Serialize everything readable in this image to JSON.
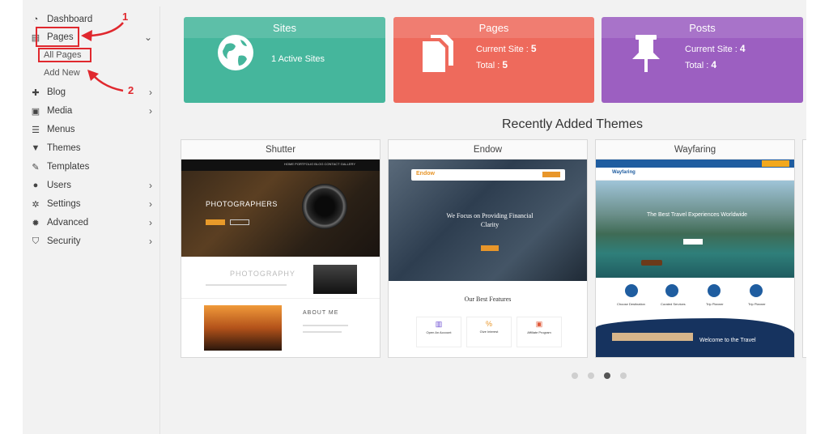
{
  "sidebar": {
    "items": [
      {
        "label": "Dashboard",
        "icon": "dashboard-icon"
      },
      {
        "label": "Pages",
        "icon": "pages-icon"
      },
      {
        "label": "Blog",
        "icon": "pin-icon"
      },
      {
        "label": "Media",
        "icon": "media-icon"
      },
      {
        "label": "Menus",
        "icon": "menu-list-icon"
      },
      {
        "label": "Themes",
        "icon": "brush-icon"
      },
      {
        "label": "Templates",
        "icon": "pencil-icon"
      },
      {
        "label": "Users",
        "icon": "user-icon"
      },
      {
        "label": "Settings",
        "icon": "gears-icon"
      },
      {
        "label": "Advanced",
        "icon": "cog-icon"
      },
      {
        "label": "Security",
        "icon": "shield-icon"
      }
    ],
    "pages_submenu": [
      "All Pages",
      "Add New"
    ]
  },
  "annotations": {
    "step1": "1",
    "step2": "2"
  },
  "cards": {
    "sites": {
      "title": "Sites",
      "line1": "1 Active Sites",
      "color": "#45b69c"
    },
    "pages": {
      "title": "Pages",
      "current_label": "Current Site :",
      "current_value": "5",
      "total_label": "Total :",
      "total_value": "5",
      "color": "#ee6a5c"
    },
    "posts": {
      "title": "Posts",
      "current_label": "Current Site :",
      "current_value": "4",
      "total_label": "Total :",
      "total_value": "4",
      "color": "#9c5fc1"
    }
  },
  "themes_section": {
    "title": "Recently Added Themes",
    "themes": [
      {
        "name": "Shutter",
        "preview": {
          "nav_links": "HOME   PORTFOLIO   BLOG   CONTACT   GALLERY",
          "hero_text": "PHOTOGRAPHERS",
          "section_text": "PHOTOGRAPHY",
          "about_text": "ABOUT ME"
        }
      },
      {
        "name": "Endow",
        "preview": {
          "brand": "Endow",
          "hero_text": "We Focus on Providing Financial Clarity",
          "features_title": "Our Best Features",
          "features": [
            "Open An Account",
            "Give Interest",
            "Affiliate Program"
          ]
        }
      },
      {
        "name": "Wayfaring",
        "preview": {
          "brand": "Wayfaring",
          "hero_text": "The Best Travel Experiences Worldwide",
          "services": [
            "Choose Destination",
            "Curated Services",
            "Trip Planner",
            "Trip Planner"
          ],
          "footer_text": "Welcome to the Travel"
        }
      }
    ]
  },
  "carousel": {
    "active_index": 2,
    "count": 4
  }
}
